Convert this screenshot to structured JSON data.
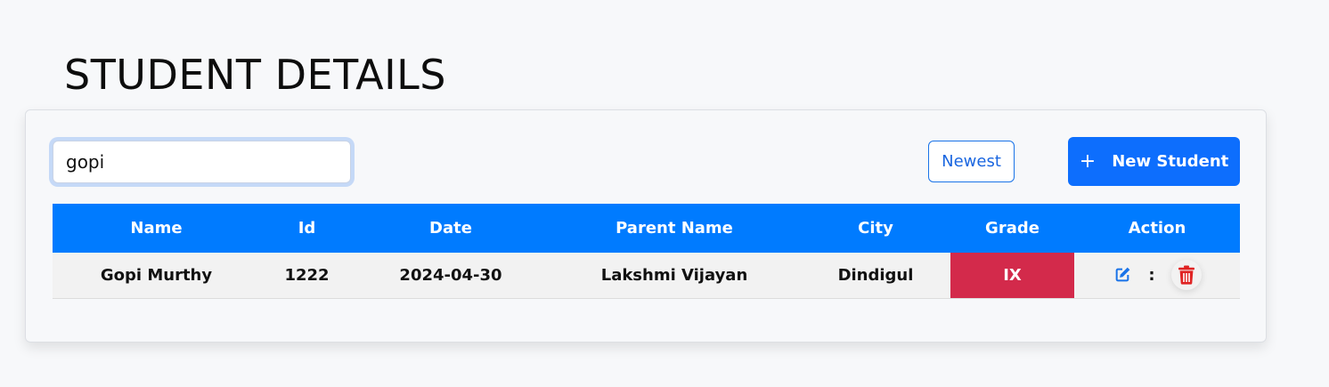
{
  "page": {
    "title": "STUDENT DETAILS"
  },
  "toolbar": {
    "search_value": "gopi",
    "sort_label": "Newest",
    "new_button_label": "New Student",
    "new_button_icon": "plus-icon"
  },
  "table": {
    "headers": [
      "Name",
      "Id",
      "Date",
      "Parent Name",
      "City",
      "Grade",
      "Action"
    ],
    "rows": [
      {
        "name": "Gopi Murthy",
        "id": "1222",
        "date": "2024-04-30",
        "parent_name": "Lakshmi Vijayan",
        "city": "Dindigul",
        "grade": "IX",
        "action_separator": ":",
        "actions": [
          "edit-icon",
          "trash-icon"
        ]
      }
    ]
  },
  "colors": {
    "primary": "#0d6efd",
    "header_bg": "#007bff",
    "grade_bg": "#d32a4b",
    "edit_icon": "#1a73e8",
    "delete_icon": "#e02424"
  }
}
